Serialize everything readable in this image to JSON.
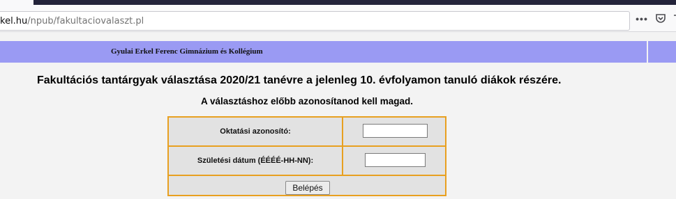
{
  "browser": {
    "url_host": "kel.hu",
    "url_path": "/npub/fakultaciovalaszt.pl",
    "toolbar_icons": [
      "more-actions-icon",
      "pocket-icon",
      "extensions-icon"
    ]
  },
  "page": {
    "banner_title": "Gyulai Erkel Ferenc Gimnázium és Kollégium",
    "heading": "Fakultációs tantárgyak választása 2020/21 tanévre a jelenleg 10. évfolyamon tanuló diákok részére.",
    "subheading": "A választáshoz előbb azonosítanod kell magad."
  },
  "form": {
    "id_label": "Oktatási azonosító:",
    "id_value": "",
    "birth_label": "Születési dátum (ÉÉÉÉ-HH-NN):",
    "birth_value": "",
    "submit_label": "Belépés"
  },
  "colors": {
    "banner": "#9a9af3",
    "form_border": "#e8a020",
    "form_background": "#e2e2e2"
  }
}
